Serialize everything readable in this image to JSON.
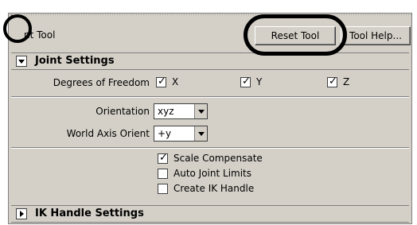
{
  "window": {
    "title": "nt Tool"
  },
  "toolbar": {
    "reset_label": "Reset Tool",
    "help_label": "Tool Help..."
  },
  "joint_settings": {
    "header": "Joint Settings",
    "dof_label": "Degrees of Freedom",
    "dof": [
      {
        "label": "X",
        "checked": true
      },
      {
        "label": "Y",
        "checked": true
      },
      {
        "label": "Z",
        "checked": true
      }
    ],
    "orientation_label": "Orientation",
    "orientation_value": "xyz",
    "world_axis_label": "World Axis Orient",
    "world_axis_value": "+y",
    "options": [
      {
        "label": "Scale Compensate",
        "checked": true
      },
      {
        "label": "Auto Joint Limits",
        "checked": false
      },
      {
        "label": "Create IK Handle",
        "checked": false
      }
    ]
  },
  "ik_settings": {
    "header": "IK Handle Settings"
  },
  "annotations": {
    "color": "#000000"
  }
}
